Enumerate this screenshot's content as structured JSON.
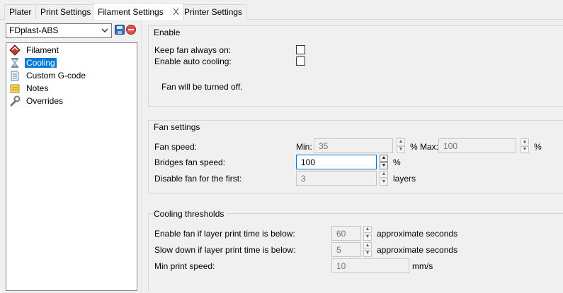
{
  "tabs": [
    {
      "label": "Plater"
    },
    {
      "label": "Print Settings"
    },
    {
      "label": "Filament Settings",
      "active": true,
      "close": "X"
    },
    {
      "label": "Printer Settings"
    }
  ],
  "preset": {
    "value": "FDplast-ABS"
  },
  "tree": [
    {
      "label": "Filament",
      "icon": "filament-spool-icon"
    },
    {
      "label": "Cooling",
      "icon": "hourglass-icon",
      "selected": true
    },
    {
      "label": "Custom G-code",
      "icon": "document-icon"
    },
    {
      "label": "Notes",
      "icon": "note-icon"
    },
    {
      "label": "Overrides",
      "icon": "wrench-icon"
    }
  ],
  "enable_group": {
    "title": "Enable",
    "keep_fan_label": "Keep fan always on:",
    "keep_fan_checked": false,
    "auto_cooling_label": "Enable auto cooling:",
    "auto_cooling_checked": false,
    "info": "Fan will be turned off."
  },
  "fan_group": {
    "title": "Fan settings",
    "fan_speed_label": "Fan speed:",
    "min_label": "Min:",
    "min_value": "35",
    "min_unit": "% Max:",
    "max_value": "100",
    "max_unit": "%",
    "bridges_label": "Bridges fan speed:",
    "bridges_value": "100",
    "bridges_unit": "%",
    "disable_label": "Disable fan for the first:",
    "disable_value": "3",
    "disable_unit": "layers"
  },
  "thresholds_group": {
    "title": "Cooling thresholds",
    "enable_fan_label": "Enable fan if layer print time is below:",
    "enable_fan_value": "60",
    "enable_fan_unit": "approximate seconds",
    "slow_down_label": "Slow down if layer print time is below:",
    "slow_down_value": "5",
    "slow_down_unit": "approximate seconds",
    "min_speed_label": "Min print speed:",
    "min_speed_value": "10",
    "min_speed_unit": "mm/s"
  },
  "spin_arrows": {
    "up": "▲",
    "down": "▼"
  }
}
